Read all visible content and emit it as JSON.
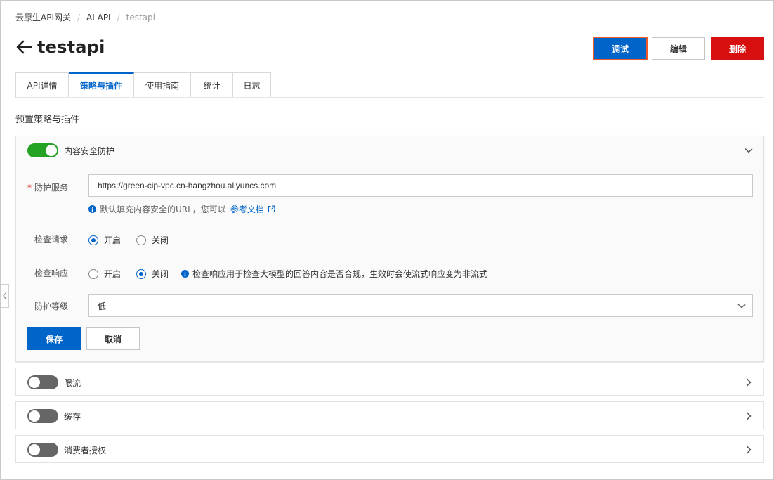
{
  "breadcrumb": {
    "items": [
      "云原生API网关",
      "AI API",
      "testapi"
    ]
  },
  "page": {
    "title": "testapi"
  },
  "header_actions": {
    "debug": "调试",
    "edit": "编辑",
    "delete": "删除"
  },
  "tabs": [
    {
      "label": "API详情",
      "active": false
    },
    {
      "label": "策略与插件",
      "active": true
    },
    {
      "label": "使用指南",
      "active": false
    },
    {
      "label": "统计",
      "active": false
    },
    {
      "label": "日志",
      "active": false
    }
  ],
  "section_title": "预置策略与插件",
  "content_security": {
    "label": "内容安全防护",
    "enabled": true,
    "expanded": true,
    "service_label": "防护服务",
    "service_value": "https://green-cip-vpc.cn-hangzhou.aliyuncs.com",
    "service_hint": "默认填充内容安全的URL，您可以",
    "service_hint_link": "参考文档",
    "check_request_label": "检查请求",
    "check_request_options": [
      "开启",
      "关闭"
    ],
    "check_request_selected": "开启",
    "check_response_label": "检查响应",
    "check_response_options": [
      "开启",
      "关闭"
    ],
    "check_response_selected": "关闭",
    "check_response_hint": "检查响应用于检查大模型的回答内容是否合规，生效时会使流式响应变为非流式",
    "level_label": "防护等级",
    "level_value": "低",
    "save": "保存",
    "cancel": "取消"
  },
  "plugins": [
    {
      "label": "限流",
      "enabled": false
    },
    {
      "label": "缓存",
      "enabled": false
    },
    {
      "label": "消费者授权",
      "enabled": false
    }
  ],
  "colors": {
    "primary": "#0064c8",
    "danger": "#d80f0f",
    "toggle_on": "#23a223",
    "toggle_off": "#666666",
    "highlight_border": "#f05a28"
  }
}
